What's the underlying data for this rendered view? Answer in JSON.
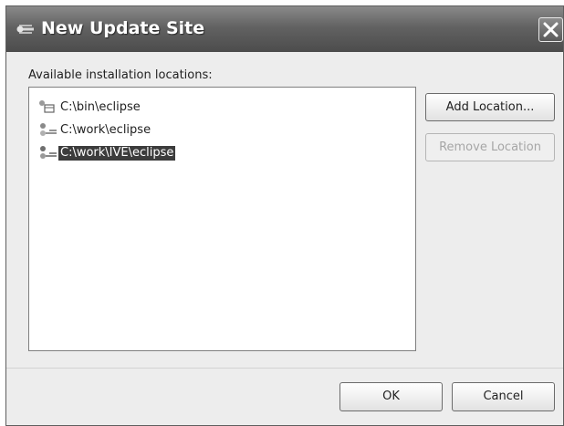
{
  "window": {
    "title": "New Update Site",
    "title_icon": "eclipse-icon",
    "close_icon": "close-icon"
  },
  "locations": {
    "label": "Available installation locations:",
    "items": [
      {
        "label": "C:\\bin\\eclipse",
        "icon": "site-folder-icon",
        "selected": false
      },
      {
        "label": "C:\\work\\eclipse",
        "icon": "site-link-icon",
        "selected": false
      },
      {
        "label": "C:\\work\\IVE\\eclipse",
        "icon": "site-link-icon",
        "selected": true
      }
    ]
  },
  "buttons": {
    "add_location": "Add Location...",
    "remove_location": "Remove Location",
    "remove_enabled": false,
    "ok": "OK",
    "cancel": "Cancel"
  },
  "colors": {
    "titlebar": "#5a5a5a",
    "selection": "#3c3c3c",
    "dialog_bg": "#ededed"
  }
}
